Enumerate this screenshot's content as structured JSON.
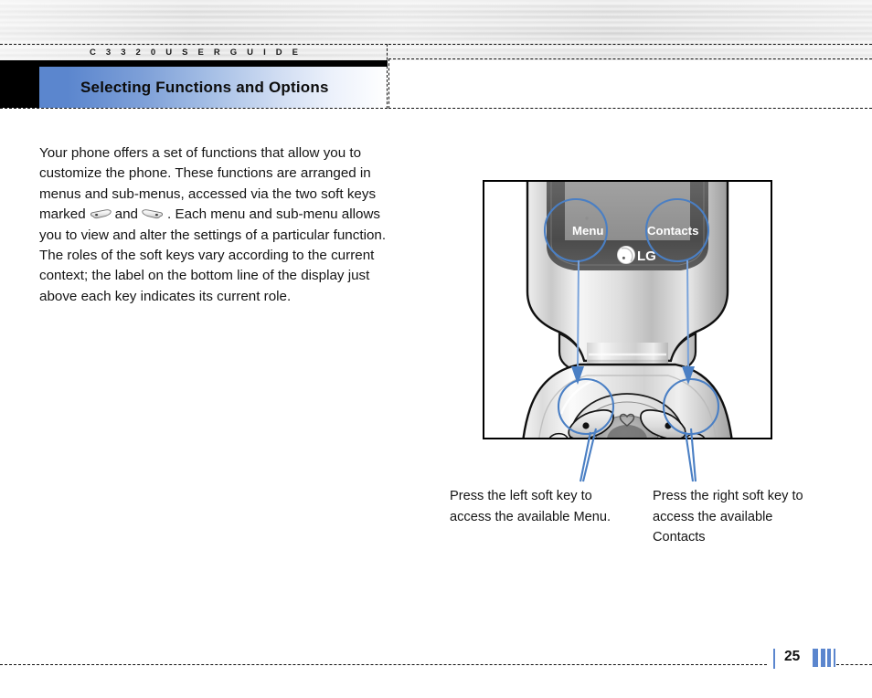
{
  "page": {
    "running_head": "C 3 3 2 0   U S E R   G U I D E",
    "title": "Selecting Functions and Options",
    "page_number": "25",
    "accent_blue": "#5b86ce",
    "annotation_blue": "#4a7fc4"
  },
  "body": {
    "para1_a": "Your phone offers a set of functions that allow you to customize the phone. These functions are arranged in menus and sub-menus, accessed via the two soft keys marked",
    "para1_and": "and",
    "para1_b": ". Each menu and sub-menu allows you to view and alter the settings of a particular function.",
    "para2": "The roles of the soft keys vary according to the current context; the label on the bottom line of the display just above each key indicates its current role."
  },
  "figure": {
    "screen_softkey_left": "Menu",
    "screen_softkey_right": "Contacts",
    "brand_logo": "LG"
  },
  "captions": {
    "left": "Press the left soft key to access the available Menu.",
    "right": "Press the right soft key to access the available Contacts"
  }
}
